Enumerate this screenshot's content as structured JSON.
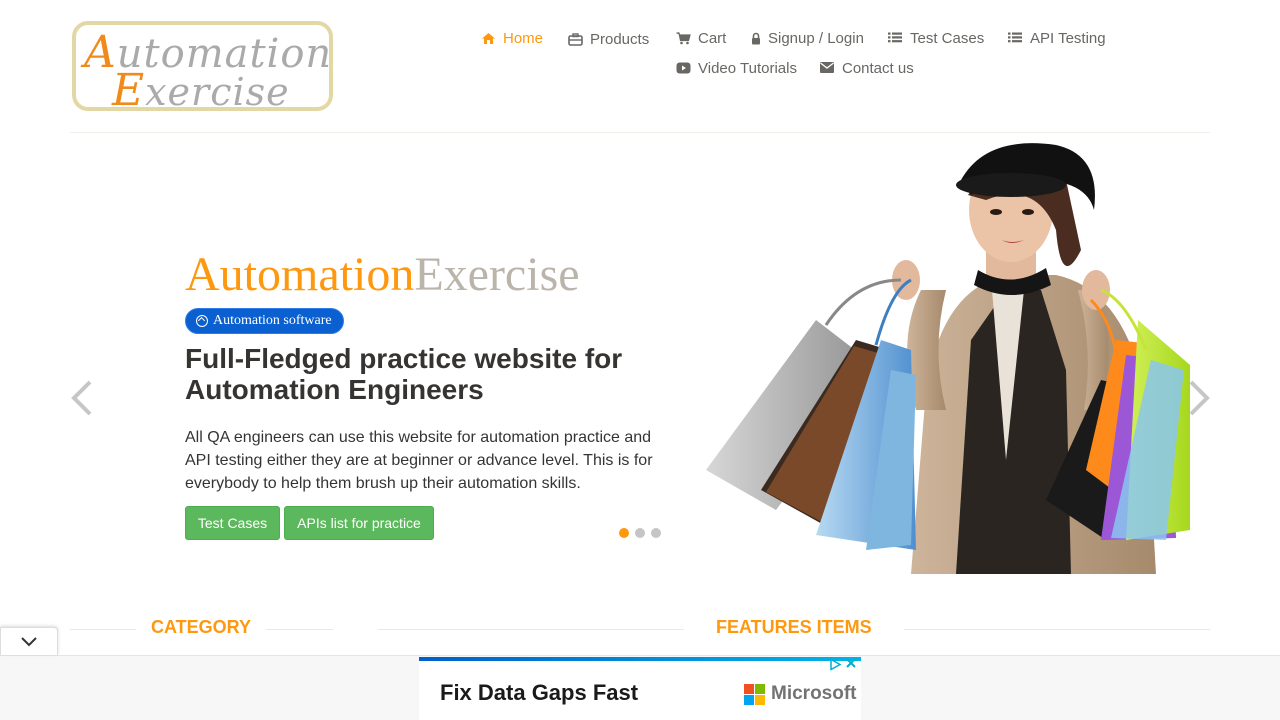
{
  "logo": {
    "line1_cap": "A",
    "line1_rest": "utomation",
    "line2_cap": "E",
    "line2_rest": "xercise"
  },
  "nav": {
    "items": [
      {
        "label": "Home",
        "icon": "home-icon",
        "active": true
      },
      {
        "label": "Products",
        "icon": "briefcase-icon"
      },
      {
        "label": "Cart",
        "icon": "cart-icon"
      },
      {
        "label": "Signup / Login",
        "icon": "lock-icon"
      },
      {
        "label": "Test Cases",
        "icon": "list-icon"
      },
      {
        "label": "API Testing",
        "icon": "list-icon"
      },
      {
        "label": "Video Tutorials",
        "icon": "youtube-play-icon"
      },
      {
        "label": "Contact us",
        "icon": "envelope-icon"
      }
    ]
  },
  "slider": {
    "brand_a": "Automation",
    "brand_b": "Exercise",
    "badge": "Automation software",
    "headline": "Full-Fledged practice website for Automation Engineers",
    "description": "All QA engineers can use this website for automation practice and API testing either they are at beginner or advance level. This is for everybody to help them brush up their automation skills.",
    "buttons": [
      "Test Cases",
      "APIs list for practice"
    ],
    "active_slide": 1,
    "slide_count": 3
  },
  "sections": {
    "left": "CATEGORY",
    "right": "FEATURES ITEMS"
  },
  "ad": {
    "headline": "Fix Data Gaps Fast",
    "advertiser": "Microsoft"
  },
  "colors": {
    "accent": "#fe980f",
    "button": "#5cb85c",
    "badge": "#0a60d0"
  }
}
